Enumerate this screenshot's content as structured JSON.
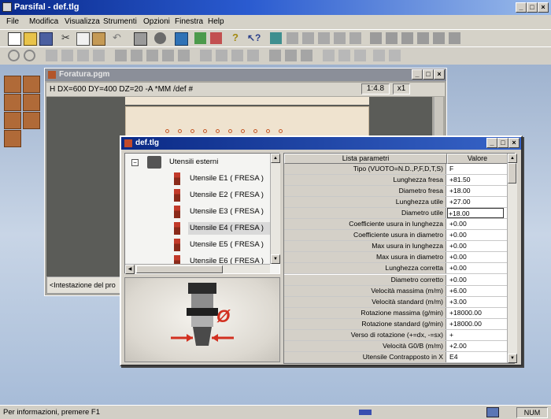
{
  "app": {
    "title": "Parsifal - def.tlg",
    "menu": [
      "File",
      "Modifica",
      "Visualizza",
      "Strumenti",
      "Opzioni",
      "Finestra",
      "Help"
    ]
  },
  "foratura": {
    "title": "Foratura.pgm",
    "command": "H DX=600 DY=400 DZ=20 -A *MM /def #",
    "zoom": "1:4.8",
    "scale": "x1",
    "footer": "<Intestazione del pro"
  },
  "def_window": {
    "title": "def.tlg",
    "tree_root": "Utensili esterni",
    "tools": [
      {
        "label": "Utensile E1 ( FRESA )",
        "selected": false
      },
      {
        "label": "Utensile E2 ( FRESA )",
        "selected": false
      },
      {
        "label": "Utensile E3 ( FRESA )",
        "selected": false
      },
      {
        "label": "Utensile E4 ( FRESA )",
        "selected": true
      },
      {
        "label": "Utensile E5 ( FRESA )",
        "selected": false
      },
      {
        "label": "Utensile E6 ( FRESA )",
        "selected": false
      }
    ],
    "diameter_symbol": "Ø",
    "grid": {
      "headers": [
        "Lista parametri",
        "Valore"
      ],
      "rows": [
        [
          "Tipo (VUOTO=N.D.,P,F,D,T,S)",
          "F"
        ],
        [
          "Lunghezza fresa",
          "+81.50"
        ],
        [
          "Diametro fresa",
          "+18.00"
        ],
        [
          "Lunghezza utile",
          "+27.00"
        ],
        [
          "Diametro utile",
          "+18.00"
        ],
        [
          "Coefficiente usura in lunghezza",
          "+0.00"
        ],
        [
          "Coefficiente usura in diametro",
          "+0.00"
        ],
        [
          "Max usura in lunghezza",
          "+0.00"
        ],
        [
          "Max usura in diametro",
          "+0.00"
        ],
        [
          "Lunghezza corretta",
          "+0.00"
        ],
        [
          "Diametro corretto",
          "+0.00"
        ],
        [
          "Velocità massima (m/m)",
          "+6.00"
        ],
        [
          "Velocità standard (m/m)",
          "+3.00"
        ],
        [
          "Rotazione massima (g/min)",
          "+18000.00"
        ],
        [
          "Rotazione standard (g/min)",
          "+18000.00"
        ],
        [
          "Verso di rotazione (+=dx, -=sx)",
          "+"
        ],
        [
          "Velocità G0/B (m/m)",
          "+2.00"
        ],
        [
          "Utensile Contrapposto in X",
          "E4"
        ]
      ]
    }
  },
  "status": {
    "hint": "Per informazioni, premere F1",
    "num": "NUM"
  }
}
